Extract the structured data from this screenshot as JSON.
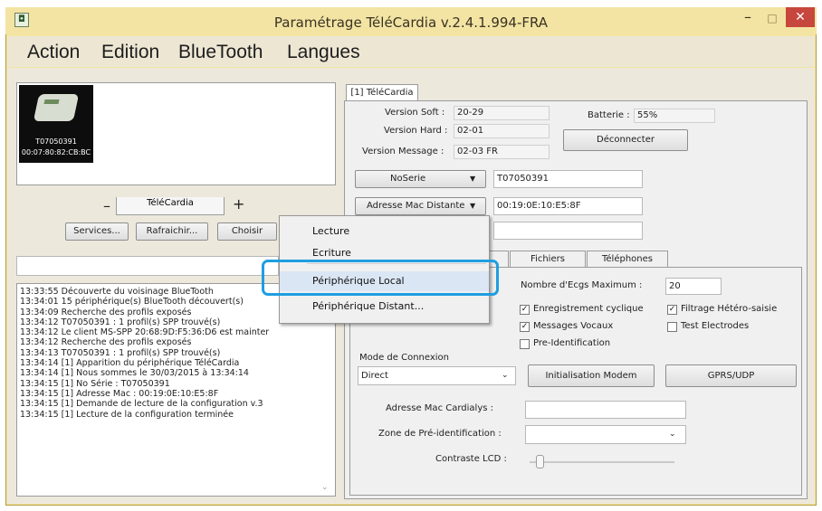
{
  "window": {
    "title": "Paramétrage TéléCardia v.2.4.1.994-FRA",
    "minimize": "–",
    "maximize": "□",
    "close": "✕"
  },
  "menu": [
    "Action",
    "Edition",
    "BlueTooth",
    "Langues"
  ],
  "device": {
    "id": "T07050391",
    "mac": "00:07:80:82:CB:BC",
    "name": "TéléCardia",
    "minus": "–",
    "plus": "+"
  },
  "buttons": {
    "services": "Services...",
    "refresh": "Rafraichir...",
    "choose": "Choisir",
    "disconnect": "Déconnecter",
    "init_modem": "Initialisation Modem",
    "gprs": "GPRS/UDP"
  },
  "log": [
    "13:33:55 Découverte du voisinage BlueTooth",
    "13:34:01 15 périphérique(s) BlueTooth découvert(s)",
    "13:34:09 Recherche des profils exposés",
    "13:34:12 T07050391 : 1 profil(s) SPP trouvé(s)",
    "13:34:12 Le client MS-SPP 20:68:9D:F5:36:D6 est mainter",
    "13:34:12 Recherche des profils exposés",
    "13:34:13 T07050391 : 1 profil(s) SPP trouvé(s)",
    "13:34:14 [1] Apparition du périphérique TéléCardia",
    "13:34:14 [1] Nous sommes le 30/03/2015 à 13:34:14",
    "13:34:15 [1] No Série : T07050391",
    "13:34:15 [1] Adresse Mac : 00:19:0E:10:E5:8F",
    "13:34:15 [1] Demande de lecture de la configuration v.3",
    "13:34:15 [1] Lecture de la configuration terminée"
  ],
  "right": {
    "tab_title": "[1] TéléCardia",
    "version_soft_label": "Version Soft :",
    "version_soft": "20-29",
    "version_hard_label": "Version Hard :",
    "version_hard": "02-01",
    "version_msg_label": "Version Message :",
    "version_msg": "02-03 FR",
    "battery_label": "Batterie :",
    "battery": "55%",
    "noserie_select": "NoSerie",
    "noserie_value": "T07050391",
    "mac_select": "Adresse Mac Distante",
    "mac_value": "00:19:0E:10:E5:8F"
  },
  "tabs": [
    "Fichiers",
    "Téléphones"
  ],
  "config": {
    "max_ecg_label": "Nombre d'Ecgs Maximum :",
    "max_ecg": "20",
    "cyclic": "Enregistrement cyclique",
    "cyclic_checked": true,
    "filter": "Filtrage Hétéro-saisie",
    "filter_checked": true,
    "voice": "Messages Vocaux",
    "voice_checked": true,
    "test": "Test Electrodes",
    "test_checked": false,
    "preid": "Pre-Identification",
    "preid_checked": false,
    "conn_mode_label": "Mode de Connexion",
    "conn_mode": "Direct",
    "mac_cardialys_label": "Adresse Mac Cardialys :",
    "preid_zone_label": "Zone de Pré-identification :",
    "contrast_label": "Contraste LCD :"
  },
  "context_menu": [
    "Lecture",
    "Ecriture",
    "Périphérique Local",
    "Périphérique Distant..."
  ],
  "colors": {
    "frame": "#f3e4a3",
    "close": "#c7463d",
    "highlight": "#1f9ee0"
  }
}
